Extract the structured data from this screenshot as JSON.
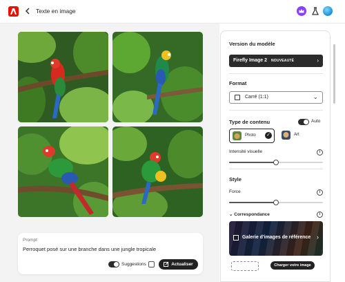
{
  "header": {
    "back_icon": "arrow-left-icon",
    "title": "Texte en image",
    "icons": [
      "adobe-logo-icon",
      "crown-icon",
      "flask-icon",
      "avatar"
    ]
  },
  "gallery": {
    "images": [
      {
        "subject": "parrot"
      },
      {
        "subject": "parrot"
      },
      {
        "subject": "parrot"
      },
      {
        "subject": "parrot"
      }
    ]
  },
  "prompt": {
    "label": "Prompt",
    "text": "Perroquet posé sur une branche dans une jungle tropicale",
    "suggestions_label": "Suggestions",
    "refresh_label": "Actualiser"
  },
  "panel": {
    "model_section": "Version du modèle",
    "model_name": "Firefly Image 2",
    "model_badge": "NOUVEAUTÉ",
    "format_section": "Format",
    "format_value": "Carré (1:1)",
    "content_type_section": "Type de contenu",
    "auto_label": "Auto",
    "content_types": [
      {
        "label": "Photo",
        "selected": true
      },
      {
        "label": "Art",
        "selected": false
      }
    ],
    "visual_intensity_label": "Intensité visuelle",
    "visual_intensity_value": 0.5,
    "style_section": "Style",
    "force_label": "Force",
    "force_value": 0.5,
    "match_label": "Correspondance",
    "reference_gallery_label": "Galerie d'images de référence",
    "upload_label": "Charger votre image"
  },
  "colors": {
    "brand_red": "#eb1000",
    "dark": "#222222",
    "canvas_bg": "#f3f3f3"
  }
}
